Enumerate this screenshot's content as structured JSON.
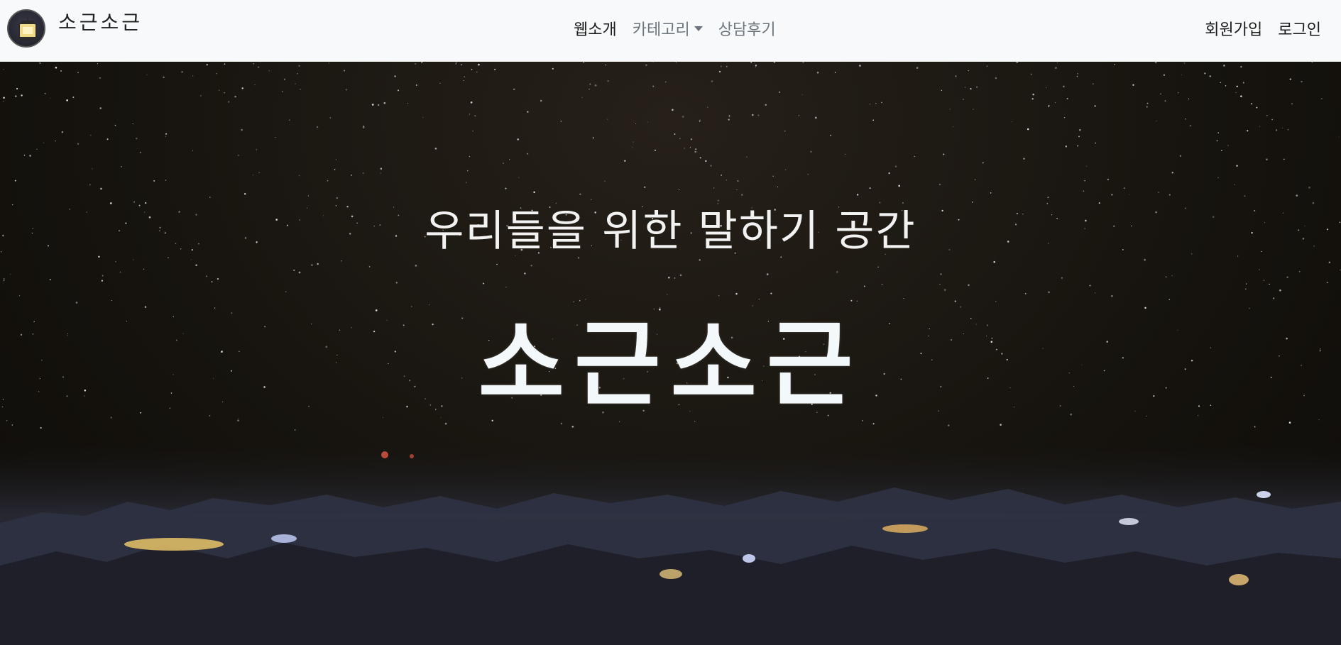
{
  "brand": {
    "name": "소근소근",
    "logo_icon": "lamp-icon"
  },
  "nav": {
    "center": [
      {
        "label": "웹소개",
        "active": true
      },
      {
        "label": "카테고리",
        "dropdown": true
      },
      {
        "label": "상담후기"
      }
    ],
    "right": [
      {
        "label": "회원가입"
      },
      {
        "label": "로그인"
      }
    ]
  },
  "hero": {
    "subtitle": "우리들을 위한 말하기 공간",
    "title": "소근소근",
    "background": "night-city-starry-sky"
  },
  "colors": {
    "navbar_bg": "#f8f9fa",
    "nav_muted": "#6c757d",
    "nav_active": "#1a1a1a",
    "hero_text": "#f3f8fa"
  }
}
